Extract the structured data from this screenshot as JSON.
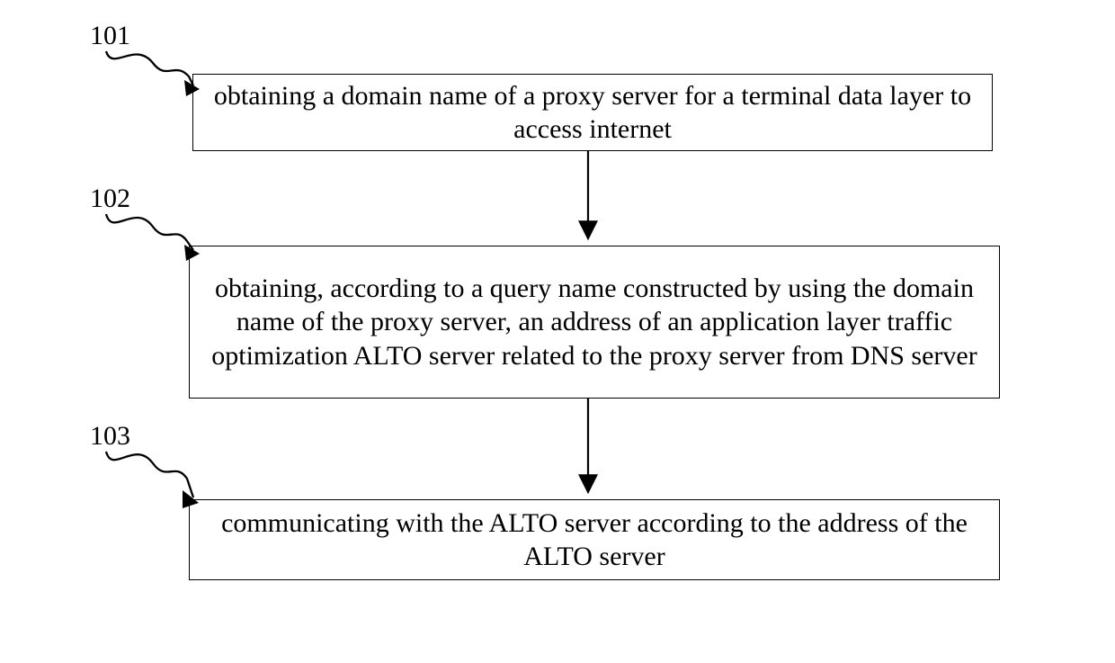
{
  "chart_data": {
    "type": "flowchart",
    "steps": [
      {
        "id": "101",
        "text": "obtaining a domain name of a proxy server for a terminal data layer to access internet"
      },
      {
        "id": "102",
        "text": "obtaining, according to a query name constructed by using the domain name of the proxy server, an address of an application layer traffic optimization ALTO server related to the proxy server from DNS server"
      },
      {
        "id": "103",
        "text": "communicating with the ALTO server according to the address of the ALTO server"
      }
    ],
    "edges": [
      {
        "from": "101",
        "to": "102"
      },
      {
        "from": "102",
        "to": "103"
      }
    ]
  },
  "labels": {
    "l1": "101",
    "l2": "102",
    "l3": "103"
  },
  "boxes": {
    "b1": "obtaining a domain name of a proxy server for a terminal data layer to access internet",
    "b2": "obtaining, according to a query name constructed by using the domain name of the proxy server, an address of an application layer traffic optimization ALTO server related to the proxy server from DNS server",
    "b3": "communicating with the ALTO server according to the address of the ALTO server"
  }
}
